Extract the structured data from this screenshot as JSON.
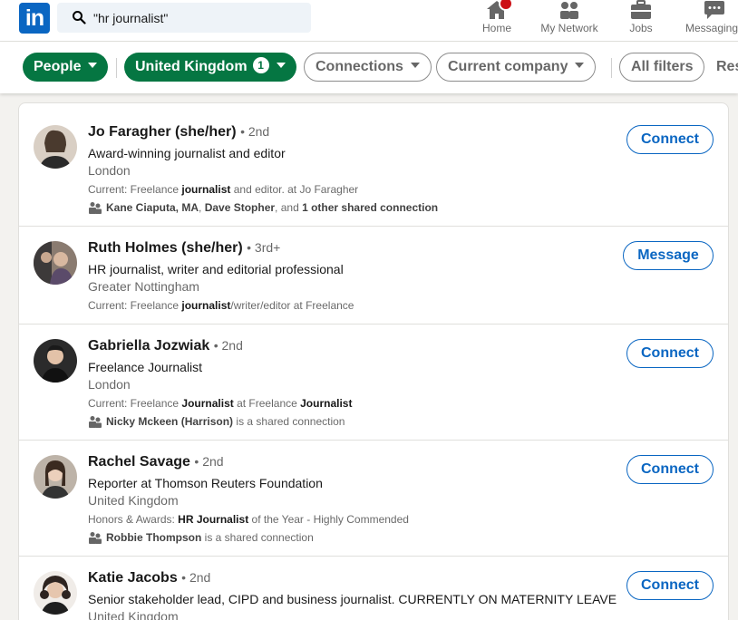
{
  "nav": {
    "logo_text": "in",
    "search_value": "\"hr journalist\"",
    "items": [
      {
        "label": "Home",
        "icon": "home-icon"
      },
      {
        "label": "My Network",
        "icon": "people-icon"
      },
      {
        "label": "Jobs",
        "icon": "briefcase-icon"
      },
      {
        "label": "Messaging",
        "icon": "chat-icon"
      }
    ]
  },
  "filters": {
    "people": "People",
    "country": "United Kingdom",
    "country_count": "1",
    "connections": "Connections",
    "current_company": "Current company",
    "all_filters": "All filters",
    "reset": "Reset"
  },
  "results": [
    {
      "name": "Jo Faragher (she/her)",
      "degree": "• 2nd",
      "headline": "Award-winning journalist and editor",
      "location": "London",
      "current_prefix": "Current: Freelance ",
      "current_bold": "journalist",
      "current_suffix": " and editor. at Jo Faragher",
      "shared_1": "Kane Ciaputa, MA",
      "shared_sep": ", ",
      "shared_2": "Dave Stopher",
      "shared_mid": ", and ",
      "shared_3": "1 other shared connection",
      "action": "Connect"
    },
    {
      "name": "Ruth Holmes (she/her)",
      "degree": "• 3rd+",
      "headline": "HR journalist, writer and editorial professional",
      "location": "Greater Nottingham",
      "current_prefix": "Current: Freelance ",
      "current_bold": "journalist",
      "current_suffix": "/writer/editor at Freelance",
      "action": "Message"
    },
    {
      "name": "Gabriella Jozwiak",
      "degree": "• 2nd",
      "headline": "Freelance Journalist",
      "location": "London",
      "current_prefix": "Current: Freelance ",
      "current_bold": "Journalist",
      "current_suffix": " at Freelance ",
      "current_bold2": "Journalist",
      "shared_1": "Nicky Mckeen (Harrison)",
      "shared_tail": " is a shared connection",
      "action": "Connect"
    },
    {
      "name": "Rachel Savage",
      "degree": "• 2nd",
      "headline": "Reporter at Thomson Reuters Foundation",
      "location": "United Kingdom",
      "current_prefix": "Honors & Awards: ",
      "current_bold": "HR Journalist",
      "current_suffix": " of the Year - Highly Commended",
      "shared_1": "Robbie Thompson",
      "shared_tail": " is a shared connection",
      "action": "Connect"
    },
    {
      "name": "Katie Jacobs",
      "degree": "• 2nd",
      "headline": "Senior stakeholder lead, CIPD and business journalist. CURRENTLY ON MATERNITY LEAVE",
      "location": "United Kingdom",
      "action": "Connect"
    }
  ],
  "colors": {
    "brand": "#0a66c2",
    "active_filter": "#057642",
    "badge": "#cc1016"
  }
}
